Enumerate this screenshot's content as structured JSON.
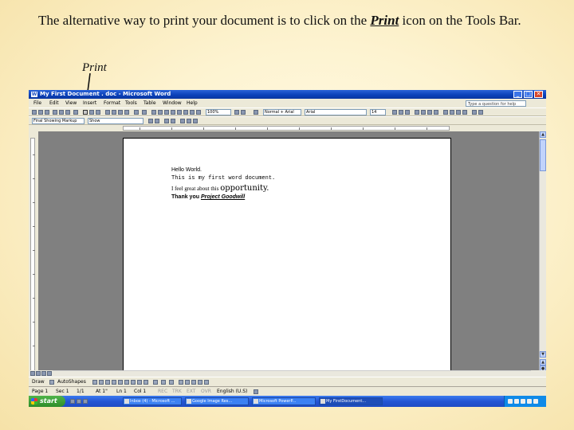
{
  "slide": {
    "caption_pre": "The alternative way to print your document is to click on the ",
    "caption_em": "Print",
    "caption_post": " icon on the Tools Bar.",
    "callout_label": "Print"
  },
  "word": {
    "title": "My First Document . doc - Microsoft Word",
    "menu": [
      "File",
      "Edit",
      "View",
      "Insert",
      "Format",
      "Tools",
      "Table",
      "Window",
      "Help"
    ],
    "help_placeholder": "Type a question for help",
    "zoom": "100%",
    "style": "Normal + Arial",
    "font": "Arial",
    "size": "14",
    "markup": "Final Showing Markup",
    "show": "Show",
    "draw_label": "Draw",
    "autoshapes_label": "AutoShapes",
    "document_lines": {
      "l1": "Hello World.",
      "l2": "This is my first word document.",
      "l3_a": "I feel great about this",
      "l3_b": "opportunity.",
      "l4_a": "Thank you",
      "l4_b": "Project Goodwill"
    },
    "status": {
      "page": "Page 1",
      "sec": "Sec 1",
      "pages": "1/1",
      "at": "At 1\"",
      "ln": "Ln 1",
      "col": "Col 1",
      "rec": "REC",
      "trk": "TRK",
      "ext": "EXT",
      "ovr": "OVR",
      "lang": "English (U.S)"
    }
  },
  "taskbar": {
    "start": "start",
    "tasks": [
      "Inbox (4) - Microsoft ...",
      "Google Image Res...",
      "Microsoft PowerP...",
      "My FirstDocument..."
    ]
  }
}
